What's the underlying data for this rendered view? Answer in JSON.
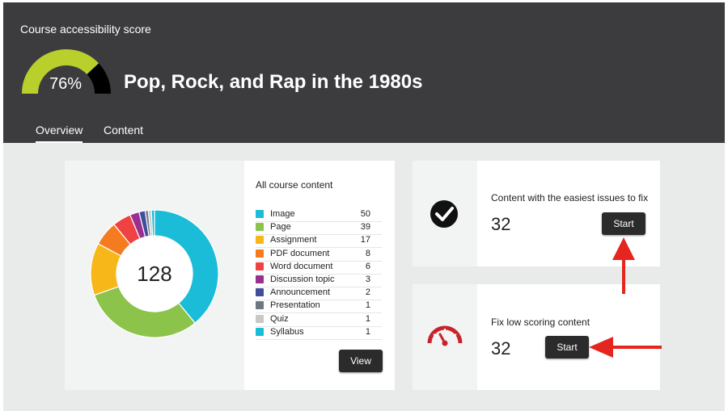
{
  "header": {
    "score_label": "Course accessibility score",
    "score_value": 76,
    "score_text": "76%",
    "course_title": "Pop, Rock, and Rap in the 1980s",
    "tabs": [
      {
        "label": "Overview",
        "active": true
      },
      {
        "label": "Content",
        "active": false
      }
    ]
  },
  "colors": {
    "header_bg": "#3c3c3f",
    "gauge_fill": "#b8cf2c",
    "gauge_rest": "#000000",
    "arrow": "#e5261f"
  },
  "content_summary": {
    "title": "All course content",
    "total": "128",
    "view_button": "View",
    "items": [
      {
        "label": "Image",
        "count": "50",
        "color": "#1bbcd8"
      },
      {
        "label": "Page",
        "count": "39",
        "color": "#8cc34a"
      },
      {
        "label": "Assignment",
        "count": "17",
        "color": "#f8b719"
      },
      {
        "label": "PDF document",
        "count": "8",
        "color": "#f57b20"
      },
      {
        "label": "Word document",
        "count": "6",
        "color": "#ef4242"
      },
      {
        "label": "Discussion topic",
        "count": "3",
        "color": "#9a2f8f"
      },
      {
        "label": "Announcement",
        "count": "2",
        "color": "#3f4d9b"
      },
      {
        "label": "Presentation",
        "count": "1",
        "color": "#6d7682"
      },
      {
        "label": "Quiz",
        "count": "1",
        "color": "#c8c8c8"
      },
      {
        "label": "Syllabus",
        "count": "1",
        "color": "#1bbcd8"
      }
    ]
  },
  "easy_fix": {
    "title": "Content with the easiest issues to fix",
    "count": "32",
    "button": "Start",
    "icon": "check-circle-icon"
  },
  "low_score": {
    "title": "Fix low scoring content",
    "count": "32",
    "button": "Start",
    "icon": "speedometer-icon"
  }
}
